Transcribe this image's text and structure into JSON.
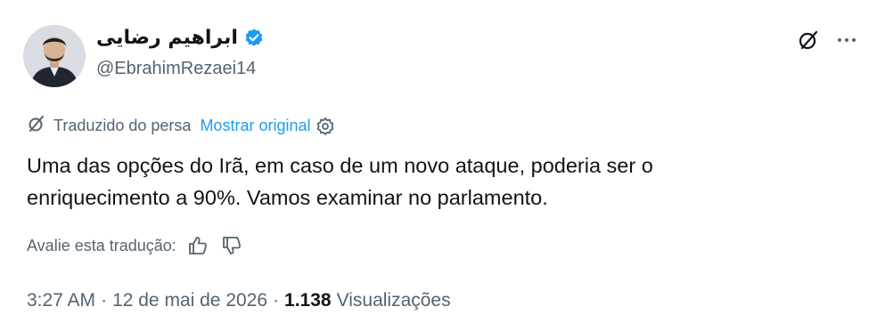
{
  "author": {
    "name": "ابراهیم رضایی",
    "handle": "@EbrahimRezaei14",
    "verified": true
  },
  "icons": {
    "grok": "grok-icon",
    "more": "more-icon",
    "translate": "translate-icon",
    "settings": "gear-icon",
    "thumbs_up": "thumbs-up-icon",
    "thumbs_down": "thumbs-down-icon",
    "verified": "verified-badge-icon"
  },
  "colors": {
    "accent": "#1d9bf0",
    "secondary_text": "#536471",
    "primary_text": "#0f1419"
  },
  "translation": {
    "note": "Traduzido do persa",
    "show_original": "Mostrar original"
  },
  "tweet": {
    "line1": "Uma das opções do Irã, em caso de um novo ataque, poderia ser o",
    "line2": "enriquecimento a 90%. Vamos examinar no parlamento."
  },
  "rating": {
    "label": "Avalie esta tradução:"
  },
  "meta": {
    "time": "3:27 AM",
    "separator": "·",
    "date": "12 de mai de 2026",
    "views_count": "1.138",
    "views_label": "Visualizações"
  }
}
